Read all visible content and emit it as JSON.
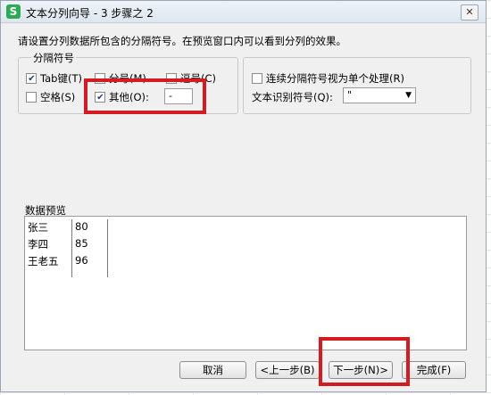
{
  "window": {
    "title": "文本分列向导 - 3 步骤之 2",
    "app_icon": "S"
  },
  "instruction": "请设置分列数据所包含的分隔符号。在预览窗口内可以看到分列的效果。",
  "delimiters": {
    "legend": "分隔符号",
    "tab": {
      "label": "Tab键(T)",
      "checked": true
    },
    "semicolon": {
      "label": "分号(M)",
      "checked": false
    },
    "comma": {
      "label": "逗号(C)",
      "checked": false
    },
    "space": {
      "label": "空格(S)",
      "checked": false
    },
    "other": {
      "label": "其他(O):",
      "checked": true,
      "value": "-"
    }
  },
  "options": {
    "consecutive": {
      "label": "连续分隔符号视为单个处理(R)",
      "checked": false
    },
    "qualifier_label": "文本识别符号(Q):",
    "qualifier_value": "\""
  },
  "preview": {
    "label": "数据预览",
    "rows": [
      {
        "name": "张三",
        "score": "80"
      },
      {
        "name": "李四",
        "score": "85"
      },
      {
        "name": "王老五",
        "score": "96"
      }
    ]
  },
  "buttons": {
    "cancel": "取消",
    "back": "<上一步(B)",
    "next": "下一步(N)>",
    "finish": "完成(F)"
  },
  "colors": {
    "highlight": "#d21c24",
    "icon": "#2eaa56"
  }
}
